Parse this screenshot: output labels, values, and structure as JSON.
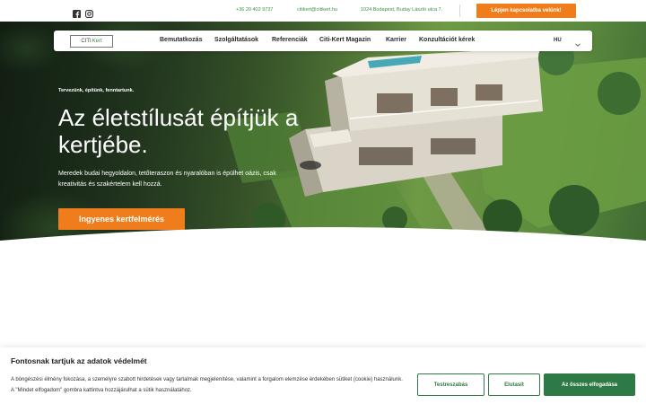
{
  "topbar": {
    "social": [
      {
        "icon": "facebook-icon"
      },
      {
        "icon": "instagram-icon"
      }
    ],
    "phone": "+36 20 403 9737",
    "email": "citikert@citikert.hu",
    "address": "1024 Budapest, Buday László utca 7.",
    "cta_label": "Lépjen kapcsolatba velünk!"
  },
  "nav": {
    "logo_text": "CITI",
    "logo_script": "Kert",
    "items": [
      "Bemutatkozás",
      "Szolgáltatások",
      "Referenciák",
      "Citi-Kert Magazin",
      "Karrier",
      "Konzultációt kérek"
    ],
    "language": "HU"
  },
  "hero": {
    "tagline": "Tervezünk, építünk, fenntartunk.",
    "headline": "Az életstílusát építjük a kertjébe.",
    "subtext": "Meredek budai hegyoldalon, tetőteraszon és nyaralóban is épülhet oázis, csak kreativitás és szakértelem kell hozzá.",
    "cta_label": "Ingyenes kertfelmérés"
  },
  "cookie": {
    "title": "Fontosnak tartjuk az adatok védelmét",
    "text": "A böngészési élmény fokozása, a személyre szabott hirdetések vagy tartalmak megjelenítése, valamint a forgalom elemzése érdekében sütiket (cookie) használunk. A \"Mindet elfogadom\" gombra kattintva hozzájárulhat a sütik használatához.",
    "customize_label": "Testreszabás",
    "reject_label": "Elutasít",
    "accept_label": "Az összes elfogadása"
  },
  "colors": {
    "accent_orange": "#f07d1c",
    "brand_green": "#2e7a44",
    "link_green": "#3e8f4a"
  }
}
